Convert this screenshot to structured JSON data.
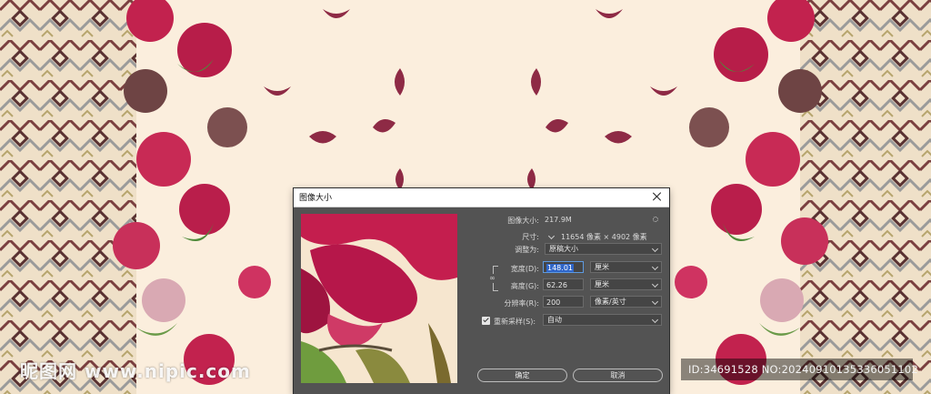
{
  "dialog": {
    "title": "图像大小",
    "image_size_label": "图像大小:",
    "image_size_value": "217.9M",
    "dimensions_label": "尺寸:",
    "dimensions_value": "11654 像素 × 4902 像素",
    "fit_to_label": "调整为:",
    "fit_to_value": "原稿大小",
    "width_label": "宽度(D):",
    "width_value": "148.01",
    "width_unit": "厘米",
    "height_label": "高度(G):",
    "height_value": "62.26",
    "height_unit": "厘米",
    "resolution_label": "分辨率(R):",
    "resolution_value": "200",
    "resolution_unit": "像素/英寸",
    "resample_label": "重新采样(S):",
    "resample_checked": true,
    "resample_value": "自动",
    "ok_label": "确定",
    "cancel_label": "取消",
    "link_icon": "chain-link-icon",
    "settings_icon": "gear-icon"
  },
  "watermark": {
    "logo_text": "昵图网 www.nipic.com",
    "id_text": "ID:34691528 NO:20240910135336051102"
  },
  "colors": {
    "canvas_background": "#fbeedd",
    "dialog_background": "#535353",
    "flower_red": "#c2224e",
    "pattern_brown": "#6b3b3b",
    "leaf_green": "#4f8a3a",
    "selection_blue": "#2f66c9"
  }
}
